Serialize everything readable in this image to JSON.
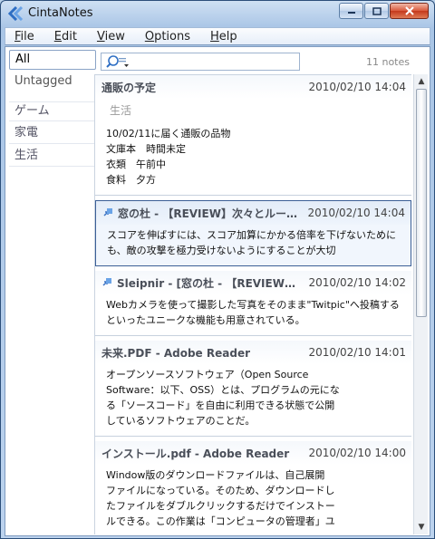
{
  "window": {
    "title": "CintaNotes"
  },
  "menu": [
    {
      "label": "File",
      "accel": "F",
      "rest": "ile"
    },
    {
      "label": "Edit",
      "accel": "E",
      "rest": "dit"
    },
    {
      "label": "View",
      "accel": "V",
      "rest": "iew"
    },
    {
      "label": "Options",
      "accel": "O",
      "rest": "ptions"
    },
    {
      "label": "Help",
      "accel": "H",
      "rest": "elp"
    }
  ],
  "sidebar": {
    "all": "All",
    "untagged": "Untagged",
    "tags": [
      "ゲーム",
      "家電",
      "生活"
    ]
  },
  "search": {
    "value": "",
    "placeholder": ""
  },
  "note_count": "11 notes",
  "notes": [
    {
      "title": "通販の予定",
      "date": "2010/02/10 14:04",
      "tag": "生活",
      "lines": [
        "10/02/11に届く通販の品物",
        "文庫本　時間未定",
        "衣類　午前中",
        "食料　夕方"
      ]
    },
    {
      "title": "窓の杜 - 【REVIEW】次々とルール...",
      "date": "2010/02/10 14:04",
      "tag": "",
      "lines": [
        "スコアを伸ばすには、スコア加算にかかる倍率を下げないために",
        "も、敵の攻撃を極力受けないようにすることが大切"
      ]
    },
    {
      "title": "Sleipnir - [窓の杜 - 【REVIEW】シ...",
      "date": "2010/02/10 14:02",
      "tag": "",
      "lines": [
        "Webカメラを使って撮影した写真をそのまま\"Twitpic\"へ投稿する",
        "といったユニークな機能も用意されている。"
      ]
    },
    {
      "title": "未来.PDF - Adobe Reader",
      "date": "2010/02/10 14:01",
      "tag": "",
      "lines": [
        "オープンソースソフトウェア（Open Source",
        "Software：以下、OSS）とは、プログラムの元にな",
        "る「ソースコード」を自由に利用できる状態で公開",
        "しているソフトウェアのことだ。"
      ]
    },
    {
      "title": "インストール.pdf - Adobe Reader",
      "date": "2010/02/10 14:00",
      "tag": "",
      "lines": [
        "Window版のダウンロードファイルは、自己展開",
        "ファイルになっている。そのため、ダウンロードし",
        "たファイルをダブルクリックするだけでインストー",
        "ルできる。この作業は「コンピュータの管理者」ユ"
      ]
    }
  ],
  "colors": {
    "selected_border": "#3b5f96",
    "accent": "#3b73c4"
  }
}
